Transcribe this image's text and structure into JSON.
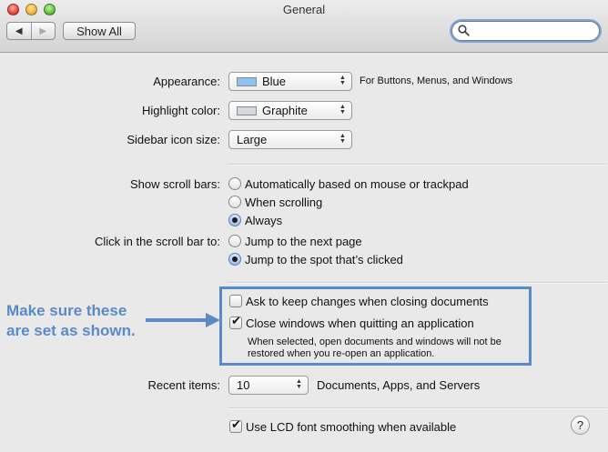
{
  "window": {
    "title": "General"
  },
  "toolbar": {
    "back_glyph": "◀",
    "forward_glyph": "▶",
    "show_all_label": "Show All",
    "search_value": "",
    "search_placeholder": ""
  },
  "appearance": {
    "label": "Appearance:",
    "value": "Blue",
    "swatch_color": "#8ec2f2",
    "note": "For Buttons, Menus, and Windows"
  },
  "highlight": {
    "label": "Highlight color:",
    "value": "Graphite",
    "swatch_color": "#d4d8df"
  },
  "sidebar_icon": {
    "label": "Sidebar icon size:",
    "value": "Large"
  },
  "scroll_bars": {
    "label": "Show scroll bars:",
    "options": [
      {
        "label": "Automatically based on mouse or trackpad",
        "selected": false
      },
      {
        "label": "When scrolling",
        "selected": false
      },
      {
        "label": "Always",
        "selected": true
      }
    ]
  },
  "click_scroll": {
    "label": "Click in the scroll bar to:",
    "options": [
      {
        "label": "Jump to the next page",
        "selected": false
      },
      {
        "label": "Jump to the spot that’s clicked",
        "selected": true
      }
    ]
  },
  "documents": {
    "ask_keep_changes": {
      "label": "Ask to keep changes when closing documents",
      "checked": false
    },
    "close_windows": {
      "label": "Close windows when quitting an application",
      "checked": true
    },
    "note_line1": "When selected, open documents and windows will not be",
    "note_line2": "restored when you re-open an application."
  },
  "annotation": {
    "line1": "Make sure these",
    "line2": "are set as shown.",
    "color": "#5b8ac8"
  },
  "recent_items": {
    "label": "Recent items:",
    "value": "10",
    "suffix": "Documents, Apps, and Servers"
  },
  "lcd_smoothing": {
    "label": "Use LCD font smoothing when available",
    "checked": true
  },
  "help": {
    "glyph": "?"
  }
}
